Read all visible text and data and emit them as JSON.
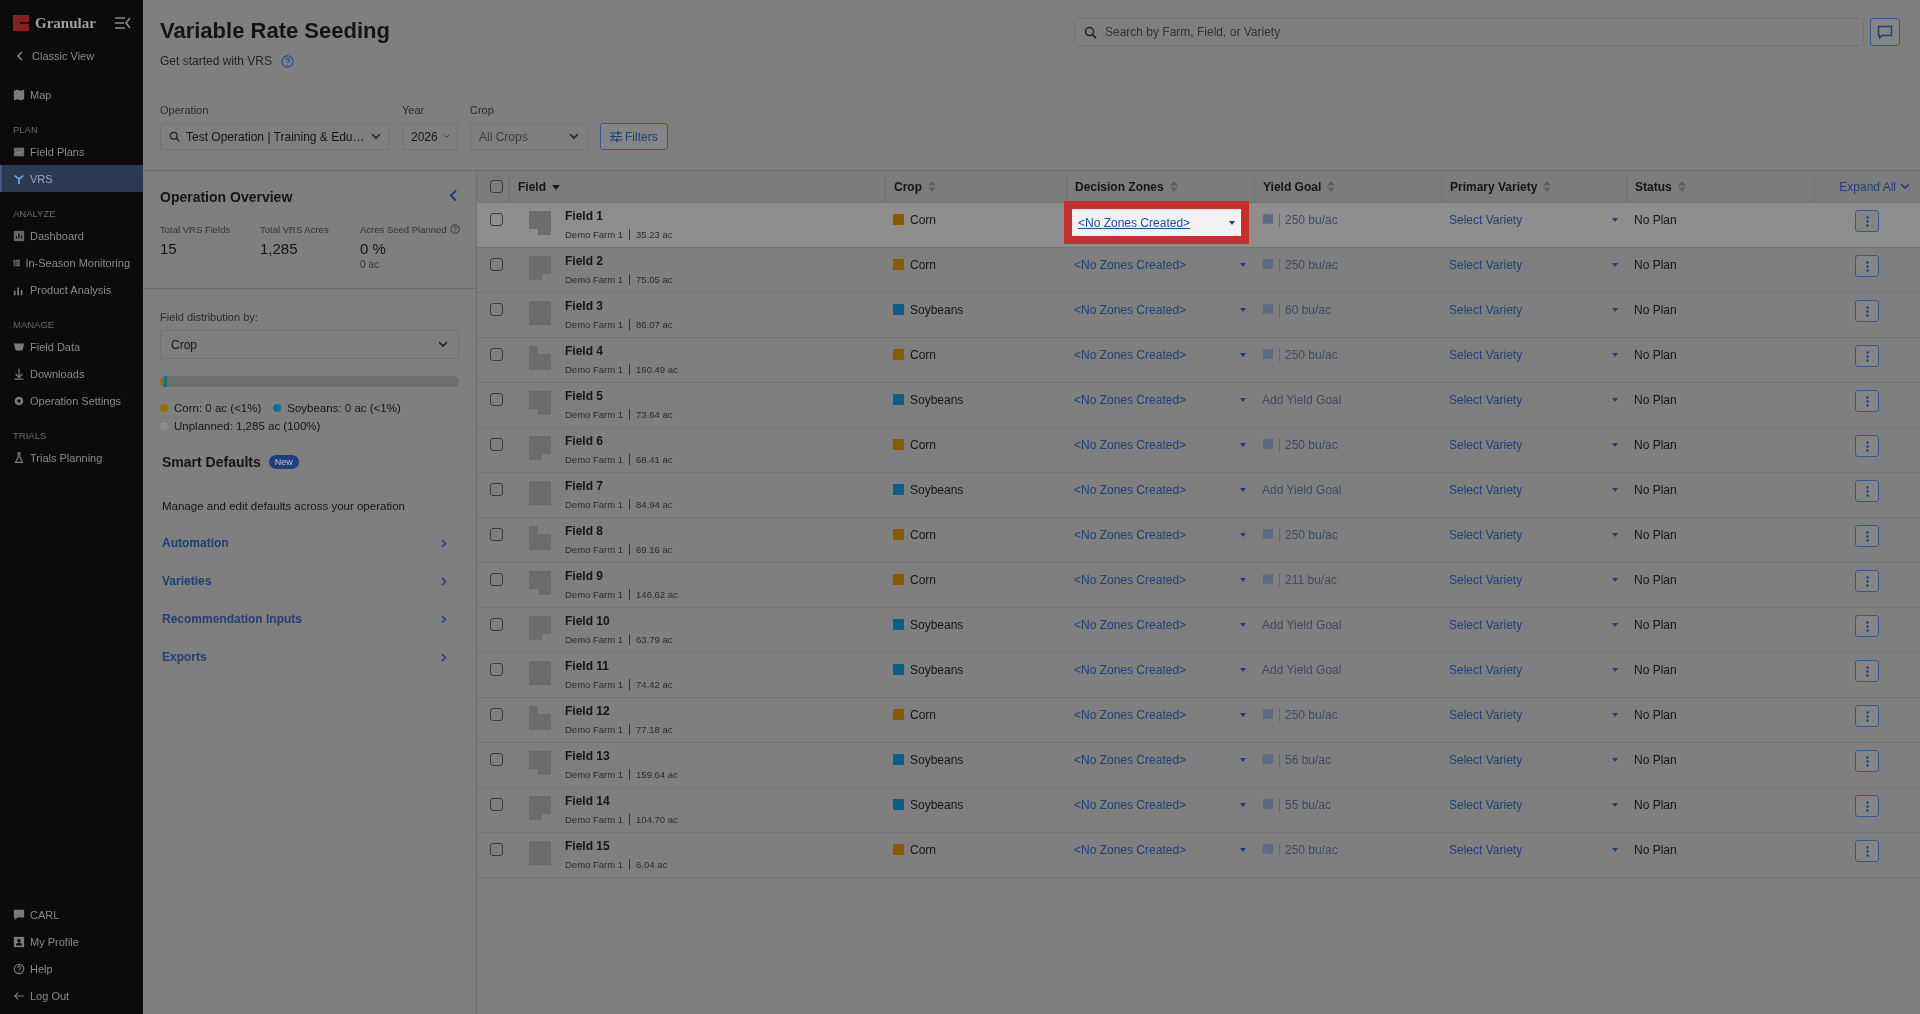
{
  "sidebar": {
    "brand": "Granular",
    "back_link": "Classic View",
    "sections": [
      {
        "items": [
          {
            "label": "Map",
            "selected": false
          }
        ]
      },
      {
        "heading": "PLAN",
        "items": [
          {
            "label": "Field Plans",
            "selected": false
          },
          {
            "label": "VRS",
            "selected": true
          }
        ]
      },
      {
        "heading": "ANALYZE",
        "items": [
          {
            "label": "Dashboard",
            "selected": false
          },
          {
            "label": "In-Season Monitoring",
            "selected": false
          },
          {
            "label": "Product Analysis",
            "selected": false
          }
        ]
      },
      {
        "heading": "MANAGE",
        "items": [
          {
            "label": "Field Data",
            "selected": false
          },
          {
            "label": "Downloads",
            "selected": false
          },
          {
            "label": "Operation Settings",
            "selected": false
          }
        ]
      },
      {
        "heading": "TRIALS",
        "items": [
          {
            "label": "Trials Planning",
            "selected": false
          }
        ]
      }
    ],
    "bottom_items": [
      {
        "label": "CARL"
      },
      {
        "label": "My Profile"
      },
      {
        "label": "Help"
      },
      {
        "label": "Log Out"
      }
    ]
  },
  "header": {
    "title": "Variable Rate Seeding",
    "subtitle": "Get started with VRS",
    "search": {
      "placeholder": "Search by Farm, Field, or Variety"
    }
  },
  "filters": [
    {
      "label": "Operation",
      "value": "Test Operation | Training & Edu…",
      "kind": "search"
    },
    {
      "label": "Year",
      "value": "2026",
      "kind": "select"
    },
    {
      "label": "Crop",
      "value": "All Crops",
      "kind": "select"
    }
  ],
  "filters_button": "Filters",
  "overview": {
    "title": "Operation Overview",
    "stats": [
      {
        "label": "Total VRS Fields",
        "value": "15"
      },
      {
        "label": "Total VRS Acres",
        "value": "1,285"
      },
      {
        "label": "Acres Seed Planned",
        "value": "0 %",
        "sub": "0 ac",
        "help": true
      }
    ],
    "distribution": {
      "label": "Field distribution by:",
      "value": "Crop",
      "segments": [
        {
          "level": 0.012,
          "color": "#a06800"
        },
        {
          "level": 0.012,
          "color": "#0b6f94"
        }
      ],
      "legend": [
        {
          "text": "Corn: 0 ac (<1%)",
          "color": "#a06800"
        },
        {
          "text": "Soybeans: 0 ac (<1%)",
          "color": "#0b6f94"
        },
        {
          "text": "Unplanned: 1,285 ac (100%)",
          "color": "#8c8c8c"
        }
      ]
    }
  },
  "smart_defaults": {
    "title": "Smart Defaults",
    "badge": "New",
    "description": "Manage and edit defaults across your operation",
    "links": [
      "Automation",
      "Varieties",
      "Recommendation Inputs",
      "Exports"
    ]
  },
  "table": {
    "columns": [
      {
        "label": "Field",
        "sorted": true
      },
      {
        "label": "Crop",
        "sorted": false
      },
      {
        "label": "Decision Zones",
        "sorted": false
      },
      {
        "label": "Yield Goal",
        "sorted": false
      },
      {
        "label": "Primary Variety",
        "sorted": false
      },
      {
        "label": "Status",
        "sorted": false
      }
    ],
    "expand_all": "Expand All",
    "all_checked": false,
    "rows": [
      {
        "field": "Field 1",
        "farm": "Demo Farm 1",
        "acres": "35.23 ac",
        "crop": "Corn",
        "color": "#8a5a00",
        "checked": false,
        "zones": "<No Zones Created>",
        "spotlighted": true,
        "hovered": true,
        "yield_goal": {
          "kind": "set",
          "text": "250 bu/ac"
        },
        "variety": "Select Variety",
        "status": "No Plan"
      },
      {
        "field": "Field 2",
        "farm": "Demo Farm 1",
        "acres": "75.05 ac",
        "checked": false,
        "crop": "Corn",
        "color": "#8a5a00",
        "zones": "<No Zones Created>",
        "spotlighted": false,
        "hovered": false,
        "yield_goal": {
          "kind": "set",
          "text": "250 bu/ac"
        },
        "variety": "Select Variety",
        "status": "No Plan"
      },
      {
        "field": "Field 3",
        "farm": "Demo Farm 1",
        "acres": "86.07 ac",
        "checked": false,
        "crop": "Soybeans",
        "color": "#0c5f86",
        "zones": "<No Zones Created>",
        "spotlighted": false,
        "hovered": false,
        "yield_goal": {
          "kind": "set",
          "text": "60 bu/ac"
        },
        "variety": "Select Variety",
        "status": "No Plan"
      },
      {
        "field": "Field 4",
        "farm": "Demo Farm 1",
        "acres": "160.49 ac",
        "checked": false,
        "crop": "Corn",
        "color": "#8a5a00",
        "zones": "<No Zones Created>",
        "spotlighted": false,
        "hovered": false,
        "yield_goal": {
          "kind": "set",
          "text": "250 bu/ac"
        },
        "variety": "Select Variety",
        "status": "No Plan"
      },
      {
        "field": "Field 5",
        "farm": "Demo Farm 1",
        "acres": "73.64 ac",
        "checked": false,
        "crop": "Soybeans",
        "color": "#0c5f86",
        "zones": "<No Zones Created>",
        "spotlighted": false,
        "hovered": false,
        "yield_goal": {
          "kind": "add",
          "text": "Add Yield Goal"
        },
        "variety": "Select Variety",
        "status": "No Plan"
      },
      {
        "field": "Field 6",
        "farm": "Demo Farm 1",
        "acres": "68.41 ac",
        "checked": false,
        "crop": "Corn",
        "color": "#8a5a00",
        "zones": "<No Zones Created>",
        "spotlighted": false,
        "hovered": false,
        "yield_goal": {
          "kind": "set",
          "text": "250 bu/ac"
        },
        "variety": "Select Variety",
        "status": "No Plan"
      },
      {
        "field": "Field 7",
        "farm": "Demo Farm 1",
        "acres": "84.94 ac",
        "checked": false,
        "crop": "Soybeans",
        "color": "#0c5f86",
        "zones": "<No Zones Created>",
        "spotlighted": false,
        "hovered": false,
        "yield_goal": {
          "kind": "add",
          "text": "Add Yield Goal"
        },
        "variety": "Select Variety",
        "status": "No Plan"
      },
      {
        "field": "Field 8",
        "farm": "Demo Farm 1",
        "acres": "69.16 ac",
        "checked": false,
        "crop": "Corn",
        "color": "#8a5a00",
        "zones": "<No Zones Created>",
        "spotlighted": false,
        "hovered": false,
        "yield_goal": {
          "kind": "set",
          "text": "250 bu/ac"
        },
        "variety": "Select Variety",
        "status": "No Plan"
      },
      {
        "field": "Field 9",
        "farm": "Demo Farm 1",
        "acres": "146.62 ac",
        "checked": false,
        "crop": "Corn",
        "color": "#8a5a00",
        "zones": "<No Zones Created>",
        "spotlighted": false,
        "hovered": false,
        "yield_goal": {
          "kind": "set",
          "text": "211 bu/ac"
        },
        "variety": "Select Variety",
        "status": "No Plan"
      },
      {
        "field": "Field 10",
        "farm": "Demo Farm 1",
        "acres": "63.79 ac",
        "checked": false,
        "crop": "Soybeans",
        "color": "#0c5f86",
        "zones": "<No Zones Created>",
        "spotlighted": false,
        "hovered": false,
        "yield_goal": {
          "kind": "add",
          "text": "Add Yield Goal"
        },
        "variety": "Select Variety",
        "status": "No Plan"
      },
      {
        "field": "Field 11",
        "farm": "Demo Farm 1",
        "acres": "74.42 ac",
        "checked": false,
        "crop": "Soybeans",
        "color": "#0c5f86",
        "zones": "<No Zones Created>",
        "spotlighted": false,
        "hovered": false,
        "yield_goal": {
          "kind": "add",
          "text": "Add Yield Goal"
        },
        "variety": "Select Variety",
        "status": "No Plan"
      },
      {
        "field": "Field 12",
        "farm": "Demo Farm 1",
        "acres": "77.18 ac",
        "checked": false,
        "crop": "Corn",
        "color": "#8a5a00",
        "zones": "<No Zones Created>",
        "spotlighted": false,
        "hovered": false,
        "yield_goal": {
          "kind": "set",
          "text": "250 bu/ac"
        },
        "variety": "Select Variety",
        "status": "No Plan"
      },
      {
        "field": "Field 13",
        "farm": "Demo Farm 1",
        "acres": "159.64 ac",
        "checked": false,
        "crop": "Soybeans",
        "color": "#0c5f86",
        "zones": "<No Zones Created>",
        "spotlighted": false,
        "hovered": false,
        "yield_goal": {
          "kind": "set",
          "text": "56 bu/ac"
        },
        "variety": "Select Variety",
        "status": "No Plan"
      },
      {
        "field": "Field 14",
        "farm": "Demo Farm 1",
        "acres": "104.70 ac",
        "checked": false,
        "crop": "Soybeans",
        "color": "#0c5f86",
        "zones": "<No Zones Created>",
        "spotlighted": false,
        "hovered": false,
        "yield_goal": {
          "kind": "set",
          "text": "55 bu/ac"
        },
        "variety": "Select Variety",
        "status": "No Plan"
      },
      {
        "field": "Field 15",
        "farm": "Demo Farm 1",
        "acres": "6.04 ac",
        "checked": false,
        "crop": "Corn",
        "color": "#8a5a00",
        "zones": "<No Zones Created>",
        "spotlighted": false,
        "hovered": false,
        "yield_goal": {
          "kind": "set",
          "text": "250 bu/ac"
        },
        "variety": "Select Variety",
        "status": "No Plan"
      }
    ]
  }
}
